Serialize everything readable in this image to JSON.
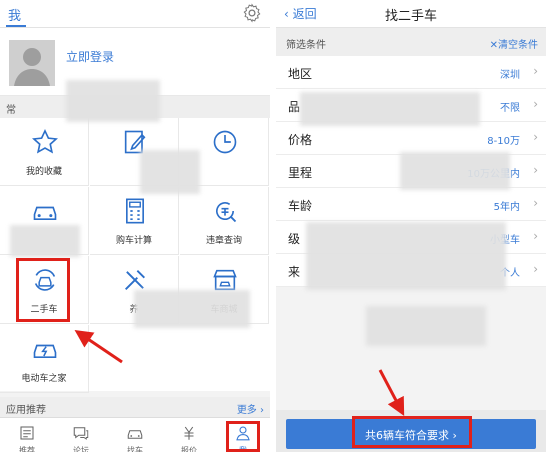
{
  "left": {
    "title": "我",
    "login": "立即登录",
    "section_common": "常",
    "grid": [
      {
        "label": "我的收藏",
        "icon": "star-icon"
      },
      {
        "label": "",
        "icon": "edit-icon"
      },
      {
        "label": "",
        "icon": "clock-icon"
      },
      {
        "label": "",
        "icon": "car-icon"
      },
      {
        "label": "购车计算",
        "icon": "calculator-icon"
      },
      {
        "label": "违章查询",
        "icon": "violation-query-icon"
      },
      {
        "label": "二手车",
        "icon": "used-car-icon"
      },
      {
        "label": "养",
        "icon": "tools-icon"
      },
      {
        "label": "车商城",
        "icon": "store-icon"
      },
      {
        "label": "电动车之家",
        "icon": "electric-car-icon"
      }
    ],
    "recommend": {
      "title": "应用推荐",
      "more": "更多"
    },
    "tabs": [
      {
        "label": "推荐",
        "icon": "news-icon"
      },
      {
        "label": "论坛",
        "icon": "forum-icon"
      },
      {
        "label": "找车",
        "icon": "find-car-icon"
      },
      {
        "label": "报价",
        "icon": "price-icon"
      },
      {
        "label": "我",
        "icon": "user-icon"
      }
    ]
  },
  "right": {
    "back": "返回",
    "title": "找二手车",
    "filter_header": "筛选条件",
    "clear": "清空条件",
    "rows": [
      {
        "key": "地区",
        "value": "深圳"
      },
      {
        "key": "品",
        "value": "不限"
      },
      {
        "key": "价格",
        "value": "8-10万"
      },
      {
        "key": "里程",
        "value": "10万公里内"
      },
      {
        "key": "车龄",
        "value": "5年内"
      },
      {
        "key": "级",
        "value": "小型车"
      },
      {
        "key": "来",
        "value": "个人"
      }
    ],
    "submit": "共6辆车符合要求"
  },
  "colors": {
    "accent": "#3a7bd5",
    "highlight": "#e0211a"
  }
}
